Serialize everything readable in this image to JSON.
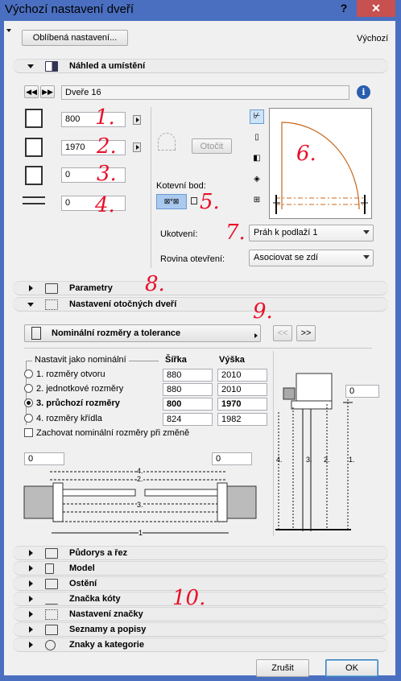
{
  "window": {
    "title": "Výchozí nastavení dveří",
    "help": "?",
    "close": "✕"
  },
  "top": {
    "favorites": "Oblíbená nastavení...",
    "defaults": "Výchozí"
  },
  "preview": {
    "section": "Náhled a umístění",
    "element_name": "Dveře 16",
    "width": "800",
    "height": "1970",
    "sill": "0",
    "offset": "0",
    "rotate": "Otočit",
    "anchor_label": "Kotevní bod:",
    "anchoring_label": "Ukotvení:",
    "anchoring_value": "Práh k podlaží 1",
    "plane_label": "Rovina otevření:",
    "plane_value": "Asociovat se zdí"
  },
  "sections_mid": {
    "parameters": "Parametry",
    "door_settings": "Nastavení otočných dveří"
  },
  "nominal": {
    "panel": "Nominální rozměry a tolerance",
    "prev": "<<",
    "next": ">>",
    "group_label": "Nastavit jako nominální",
    "col_width": "Šířka",
    "col_height": "Výška",
    "rows": [
      {
        "label": "1. rozměry otvoru",
        "w": "880",
        "h": "2010"
      },
      {
        "label": "2. jednotkové rozměry",
        "w": "880",
        "h": "2010"
      },
      {
        "label": "3. průchozí rozměry",
        "w": "800",
        "h": "1970"
      },
      {
        "label": "4. rozměry křídla",
        "w": "824",
        "h": "1982"
      }
    ],
    "keep": "Zachovat nominální rozměry při změně",
    "side_value": "0",
    "left_value": "0",
    "right_value": "0",
    "dim_labels": [
      "4.",
      "2.",
      "3.",
      "1"
    ],
    "vert_labels": [
      "4.",
      "3.",
      "2.",
      "1."
    ]
  },
  "sections_bottom": [
    "Půdorys a řez",
    "Model",
    "Ostění",
    "Značka kóty",
    "Nastavení značky",
    "Seznamy a popisy",
    "Znaky a kategorie"
  ],
  "footer": {
    "cancel": "Zrušit",
    "ok": "OK"
  },
  "annotations": [
    "1.",
    "2.",
    "3.",
    "4.",
    "5.",
    "6.",
    "7.",
    "8.",
    "9.",
    "10."
  ],
  "colors": {
    "frame": "#4a6fc0",
    "close": "#c75050",
    "annotation": "#e8102a",
    "arc": "#c8681e"
  }
}
